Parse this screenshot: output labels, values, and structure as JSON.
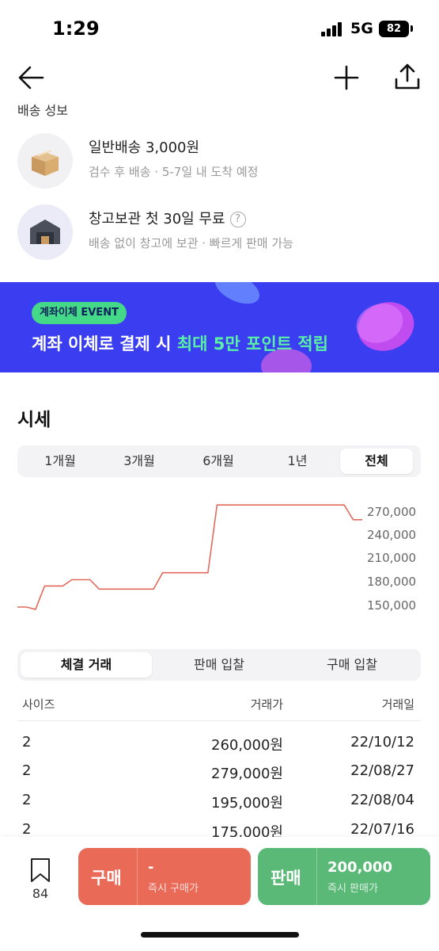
{
  "status": {
    "time": "1:29",
    "network": "5G",
    "battery": "82"
  },
  "shipping": {
    "label": "배송 성보",
    "options": [
      {
        "title": "일반배송 3,000원",
        "subtitle": "검수 후 배송 · 5-7일 내 도착 예정",
        "icon": "box-icon"
      },
      {
        "title": "창고보관 첫 30일 무료",
        "subtitle": "배송 없이 창고에 보관 · 빠르게 판매 가능",
        "icon": "warehouse-icon",
        "help": "?"
      }
    ]
  },
  "banner": {
    "badge": "계좌이체 EVENT",
    "text_prefix": "계좌 이체로 결제 시 ",
    "text_highlight": "최대 5만 포인트 적립"
  },
  "price_history": {
    "title": "시세",
    "periods": [
      "1개월",
      "3개월",
      "6개월",
      "1년",
      "전체"
    ],
    "active_period": "전체"
  },
  "chart_data": {
    "type": "line",
    "y_ticks": [
      "270,000",
      "240,000",
      "210,000",
      "180,000",
      "150,000"
    ],
    "ylim": [
      150000,
      270000
    ],
    "grid": false,
    "line_color": "#e06b5c",
    "series": [
      {
        "values": [
          148000,
          148000,
          145000,
          175000,
          175000,
          175000,
          183000,
          183000,
          183000,
          171000,
          171000,
          171000,
          171000,
          171000,
          171000,
          171000,
          192000,
          192000,
          192000,
          192000,
          192000,
          192000,
          279000,
          279000,
          279000,
          279000,
          279000,
          279000,
          279000,
          279000,
          279000,
          279000,
          279000,
          279000,
          279000,
          279000,
          279000,
          260000,
          260000
        ]
      }
    ]
  },
  "trades": {
    "tabs": [
      "체결 거래",
      "판매 입찰",
      "구매 입찰"
    ],
    "active_tab": "체결 거래",
    "headers": {
      "size": "사이즈",
      "price": "거래가",
      "date": "거래일"
    },
    "rows": [
      {
        "size": "2",
        "price": "260,000원",
        "date": "22/10/12"
      },
      {
        "size": "2",
        "price": "279,000원",
        "date": "22/08/27"
      },
      {
        "size": "2",
        "price": "195,000원",
        "date": "22/08/04"
      },
      {
        "size": "2",
        "price": "175,000원",
        "date": "22/07/16"
      }
    ]
  },
  "bottom": {
    "wish_count": "84",
    "buy": {
      "label": "구매",
      "price": "-",
      "sub": "즉시 구매가",
      "color": "#ea6a58"
    },
    "sell": {
      "label": "판매",
      "price": "200,000",
      "sub": "즉시 판매가",
      "color": "#5bb978"
    }
  }
}
